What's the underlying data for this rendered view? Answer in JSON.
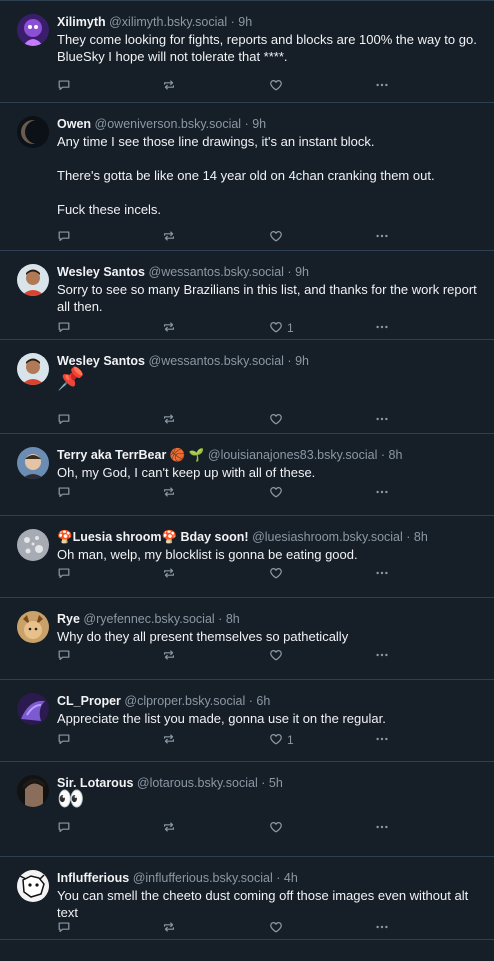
{
  "posts": [
    {
      "name": "Xilimyth",
      "handle": "@xilimyth.bsky.social",
      "time": "9h",
      "text": "They come looking for fights, reports and blocks are 100% the way to go.  BlueSky I hope will not tolerate that ****.",
      "likes": "",
      "avatar": "xilimyth-avatar"
    },
    {
      "name": "Owen",
      "handle": "@oweniverson.bsky.social",
      "time": "9h",
      "text": "Any time I see those line drawings, it's an instant block.\n\nThere's gotta be like one 14 year old on 4chan cranking them out.\n\nFuck these incels.",
      "likes": "",
      "avatar": "owen-avatar"
    },
    {
      "name": "Wesley Santos",
      "handle": "@wessantos.bsky.social",
      "time": "9h",
      "text": "Sorry to see so many Brazilians in this list, and thanks for the work report all then.",
      "likes": "1",
      "avatar": "wesley-avatar"
    },
    {
      "name": "Wesley Santos",
      "handle": "@wessantos.bsky.social",
      "time": "9h",
      "text": "📌",
      "likes": "",
      "avatar": "wesley-avatar"
    },
    {
      "name": "Terry aka TerrBear 🏀 🌱",
      "handle": "@louisianajones83.bsky.social",
      "time": "8h",
      "text": "Oh, my God, I can't keep up with all of these.",
      "likes": "",
      "avatar": "terry-avatar"
    },
    {
      "name": "🍄Luesia shroom🍄 Bday soon!",
      "handle": "@luesiashroom.bsky.social",
      "time": "8h",
      "text": "Oh man, welp, my blocklist is gonna be eating good.",
      "likes": "",
      "avatar": "luesia-avatar"
    },
    {
      "name": "Rye",
      "handle": "@ryefennec.bsky.social",
      "time": "8h",
      "text": "Why do they all present themselves so pathetically",
      "likes": "",
      "avatar": "rye-avatar"
    },
    {
      "name": "CL_Proper",
      "handle": "@clproper.bsky.social",
      "time": "6h",
      "text": "Appreciate the list you made, gonna use it on the regular.",
      "likes": "1",
      "avatar": "clproper-avatar"
    },
    {
      "name": "Sir. Lotarous",
      "handle": "@lotarous.bsky.social",
      "time": "5h",
      "text": "👀",
      "likes": "",
      "avatar": "lotarous-avatar"
    },
    {
      "name": "Influfferious",
      "handle": "@influfferious.bsky.social",
      "time": "4h",
      "text": "You can smell the cheeto dust coming off those images even without alt text",
      "likes": "",
      "avatar": "influfferious-avatar"
    }
  ],
  "colors": {
    "background": "#161e27",
    "border": "#2e4052",
    "muted": "#8b98a5",
    "text": "#f1f3f5"
  },
  "separator": "·"
}
